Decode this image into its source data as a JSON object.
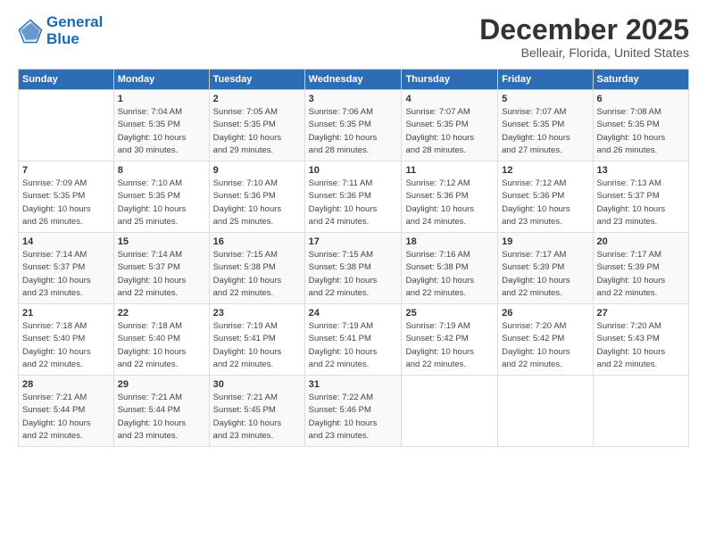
{
  "header": {
    "logo_line1": "General",
    "logo_line2": "Blue",
    "month": "December 2025",
    "location": "Belleair, Florida, United States"
  },
  "weekdays": [
    "Sunday",
    "Monday",
    "Tuesday",
    "Wednesday",
    "Thursday",
    "Friday",
    "Saturday"
  ],
  "weeks": [
    [
      {
        "day": "",
        "sunrise": "",
        "sunset": "",
        "daylight": ""
      },
      {
        "day": "1",
        "sunrise": "7:04 AM",
        "sunset": "5:35 PM",
        "daylight": "10 hours and 30 minutes."
      },
      {
        "day": "2",
        "sunrise": "7:05 AM",
        "sunset": "5:35 PM",
        "daylight": "10 hours and 29 minutes."
      },
      {
        "day": "3",
        "sunrise": "7:06 AM",
        "sunset": "5:35 PM",
        "daylight": "10 hours and 28 minutes."
      },
      {
        "day": "4",
        "sunrise": "7:07 AM",
        "sunset": "5:35 PM",
        "daylight": "10 hours and 28 minutes."
      },
      {
        "day": "5",
        "sunrise": "7:07 AM",
        "sunset": "5:35 PM",
        "daylight": "10 hours and 27 minutes."
      },
      {
        "day": "6",
        "sunrise": "7:08 AM",
        "sunset": "5:35 PM",
        "daylight": "10 hours and 26 minutes."
      }
    ],
    [
      {
        "day": "7",
        "sunrise": "7:09 AM",
        "sunset": "5:35 PM",
        "daylight": "10 hours and 26 minutes."
      },
      {
        "day": "8",
        "sunrise": "7:10 AM",
        "sunset": "5:35 PM",
        "daylight": "10 hours and 25 minutes."
      },
      {
        "day": "9",
        "sunrise": "7:10 AM",
        "sunset": "5:36 PM",
        "daylight": "10 hours and 25 minutes."
      },
      {
        "day": "10",
        "sunrise": "7:11 AM",
        "sunset": "5:36 PM",
        "daylight": "10 hours and 24 minutes."
      },
      {
        "day": "11",
        "sunrise": "7:12 AM",
        "sunset": "5:36 PM",
        "daylight": "10 hours and 24 minutes."
      },
      {
        "day": "12",
        "sunrise": "7:12 AM",
        "sunset": "5:36 PM",
        "daylight": "10 hours and 23 minutes."
      },
      {
        "day": "13",
        "sunrise": "7:13 AM",
        "sunset": "5:37 PM",
        "daylight": "10 hours and 23 minutes."
      }
    ],
    [
      {
        "day": "14",
        "sunrise": "7:14 AM",
        "sunset": "5:37 PM",
        "daylight": "10 hours and 23 minutes."
      },
      {
        "day": "15",
        "sunrise": "7:14 AM",
        "sunset": "5:37 PM",
        "daylight": "10 hours and 22 minutes."
      },
      {
        "day": "16",
        "sunrise": "7:15 AM",
        "sunset": "5:38 PM",
        "daylight": "10 hours and 22 minutes."
      },
      {
        "day": "17",
        "sunrise": "7:15 AM",
        "sunset": "5:38 PM",
        "daylight": "10 hours and 22 minutes."
      },
      {
        "day": "18",
        "sunrise": "7:16 AM",
        "sunset": "5:38 PM",
        "daylight": "10 hours and 22 minutes."
      },
      {
        "day": "19",
        "sunrise": "7:17 AM",
        "sunset": "5:39 PM",
        "daylight": "10 hours and 22 minutes."
      },
      {
        "day": "20",
        "sunrise": "7:17 AM",
        "sunset": "5:39 PM",
        "daylight": "10 hours and 22 minutes."
      }
    ],
    [
      {
        "day": "21",
        "sunrise": "7:18 AM",
        "sunset": "5:40 PM",
        "daylight": "10 hours and 22 minutes."
      },
      {
        "day": "22",
        "sunrise": "7:18 AM",
        "sunset": "5:40 PM",
        "daylight": "10 hours and 22 minutes."
      },
      {
        "day": "23",
        "sunrise": "7:19 AM",
        "sunset": "5:41 PM",
        "daylight": "10 hours and 22 minutes."
      },
      {
        "day": "24",
        "sunrise": "7:19 AM",
        "sunset": "5:41 PM",
        "daylight": "10 hours and 22 minutes."
      },
      {
        "day": "25",
        "sunrise": "7:19 AM",
        "sunset": "5:42 PM",
        "daylight": "10 hours and 22 minutes."
      },
      {
        "day": "26",
        "sunrise": "7:20 AM",
        "sunset": "5:42 PM",
        "daylight": "10 hours and 22 minutes."
      },
      {
        "day": "27",
        "sunrise": "7:20 AM",
        "sunset": "5:43 PM",
        "daylight": "10 hours and 22 minutes."
      }
    ],
    [
      {
        "day": "28",
        "sunrise": "7:21 AM",
        "sunset": "5:44 PM",
        "daylight": "10 hours and 22 minutes."
      },
      {
        "day": "29",
        "sunrise": "7:21 AM",
        "sunset": "5:44 PM",
        "daylight": "10 hours and 23 minutes."
      },
      {
        "day": "30",
        "sunrise": "7:21 AM",
        "sunset": "5:45 PM",
        "daylight": "10 hours and 23 minutes."
      },
      {
        "day": "31",
        "sunrise": "7:22 AM",
        "sunset": "5:46 PM",
        "daylight": "10 hours and 23 minutes."
      },
      {
        "day": "",
        "sunrise": "",
        "sunset": "",
        "daylight": ""
      },
      {
        "day": "",
        "sunrise": "",
        "sunset": "",
        "daylight": ""
      },
      {
        "day": "",
        "sunrise": "",
        "sunset": "",
        "daylight": ""
      }
    ]
  ],
  "labels": {
    "sunrise": "Sunrise:",
    "sunset": "Sunset:",
    "daylight": "Daylight:"
  }
}
